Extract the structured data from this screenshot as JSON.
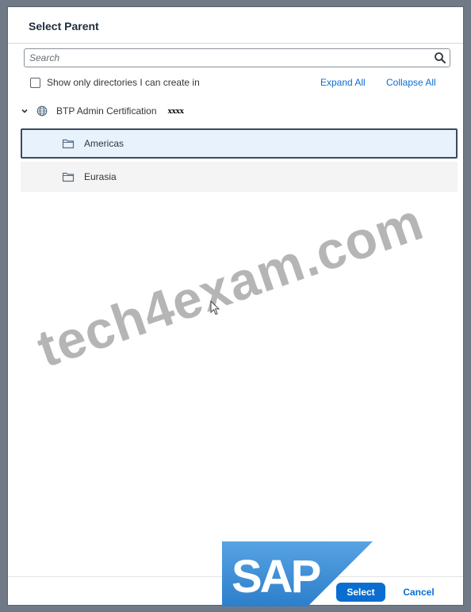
{
  "dialog": {
    "title": "Select Parent"
  },
  "search": {
    "placeholder": "Search",
    "value": "",
    "icon": "search-icon"
  },
  "filter": {
    "checked": false,
    "label": "Show only directories I can create in"
  },
  "actions": {
    "expand_all": "Expand All",
    "collapse_all": "Collapse All"
  },
  "tree": {
    "root": {
      "label": "BTP Admin Certification",
      "badge": "xxxx",
      "icon": "globe-icon",
      "expanded": true
    },
    "items": [
      {
        "label": "Americas",
        "icon": "folder-icon",
        "selected": true
      },
      {
        "label": "Eurasia",
        "icon": "folder-icon",
        "selected": false
      }
    ]
  },
  "overlays": {
    "watermark": "tech4exam.com",
    "logo": "SAP"
  },
  "footer": {
    "select_label": "Select",
    "cancel_label": "Cancel"
  },
  "colors": {
    "accent": "#0a6ed1",
    "selected_bg": "#e8f2fc",
    "selected_border": "#3a4b5e",
    "frame": "#6f7a86"
  }
}
